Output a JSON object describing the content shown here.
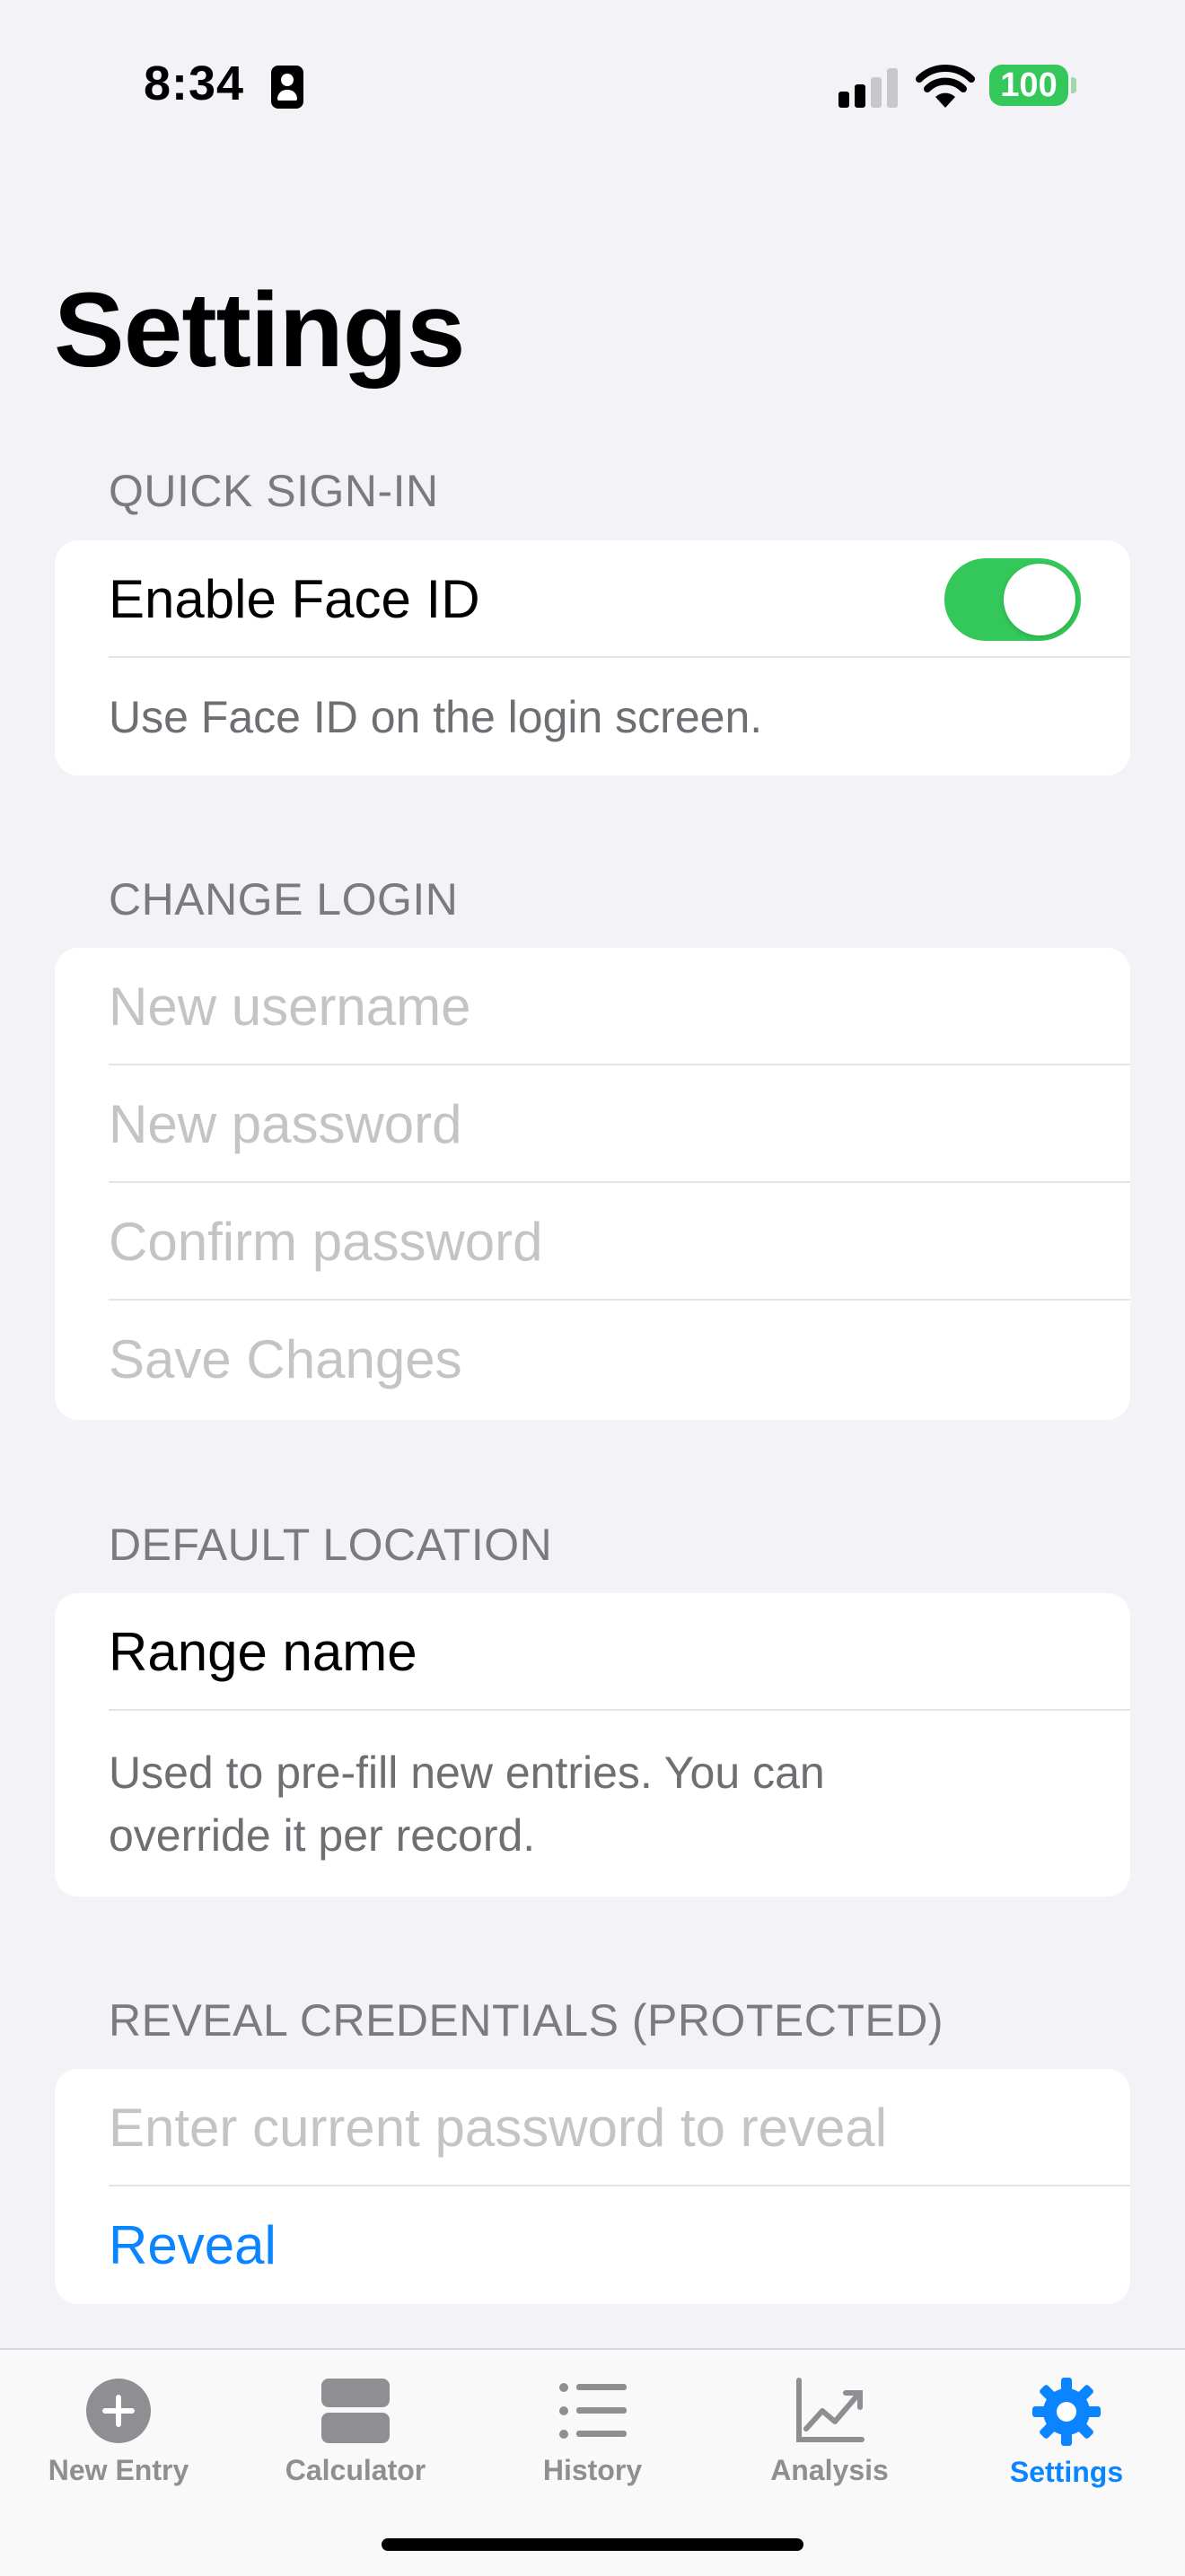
{
  "status_bar": {
    "time": "8:34",
    "battery": "100",
    "battery_color": "#34C759"
  },
  "page": {
    "title": "Settings"
  },
  "sections": {
    "quick_sign_in": {
      "header": "QUICK SIGN-IN",
      "toggle_label": "Enable Face ID",
      "toggle_on": true,
      "footnote": "Use Face ID on the login screen."
    },
    "change_login": {
      "header": "CHANGE LOGIN",
      "username_placeholder": "New username",
      "password_placeholder": "New password",
      "confirm_placeholder": "Confirm password",
      "save_label": "Save Changes"
    },
    "default_location": {
      "header": "DEFAULT LOCATION",
      "range_label": "Range name",
      "footnote_line1": "Used to pre-fill new entries. You can",
      "footnote_line2": "override it per record."
    },
    "reveal_credentials": {
      "header": "REVEAL CREDENTIALS (PROTECTED)",
      "password_placeholder": "Enter current password to reveal",
      "reveal_label": "Reveal"
    }
  },
  "tab_bar": {
    "active": "settings",
    "accent_color": "#0A84FF",
    "items": [
      {
        "id": "new_entry",
        "label": "New Entry",
        "icon": "plus-circle-icon"
      },
      {
        "id": "calculator",
        "label": "Calculator",
        "icon": "calculator-icon"
      },
      {
        "id": "history",
        "label": "History",
        "icon": "list-icon"
      },
      {
        "id": "analysis",
        "label": "Analysis",
        "icon": "chart-icon"
      },
      {
        "id": "settings",
        "label": "Settings",
        "icon": "gear-icon"
      }
    ]
  }
}
